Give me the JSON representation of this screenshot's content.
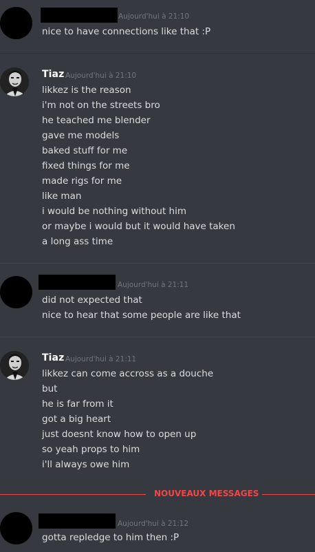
{
  "messages": [
    {
      "timestamp": "Aujourd'hui à 21:10",
      "lines": [
        "nice to have connections like that :P"
      ]
    },
    {
      "author": "Tiaz",
      "timestamp": "Aujourd'hui à 21:10",
      "lines": [
        "likkez is the reason",
        "i'm not on the streets bro",
        "he teached me blender",
        "gave me models",
        "baked stuff for me",
        "fixed things for me",
        "made rigs for me",
        "like man",
        "i would be nothing without him",
        "or maybe i would but it would have taken",
        "a long ass time"
      ]
    },
    {
      "timestamp": "Aujourd'hui à 21:11",
      "lines": [
        "did not expected that",
        "nice to hear that some people are like that"
      ]
    },
    {
      "author": "Tiaz",
      "timestamp": "Aujourd'hui à 21:11",
      "lines": [
        "likkez can come accross as a douche",
        "but",
        "he is far from it",
        "got a big heart",
        "just doesnt know how to open up",
        "so yeah props to him",
        "i'll always owe him"
      ]
    },
    {
      "timestamp": "Aujourd'hui à 21:12",
      "lines": [
        "gotta repledge to him then :P"
      ]
    }
  ],
  "new_messages_label": "NOUVEAUX MESSAGES",
  "colors": {
    "background": "#36393f",
    "text": "#dcddde",
    "timestamp": "#72767d",
    "username": "#ffffff",
    "new_messages": "#f04747"
  }
}
